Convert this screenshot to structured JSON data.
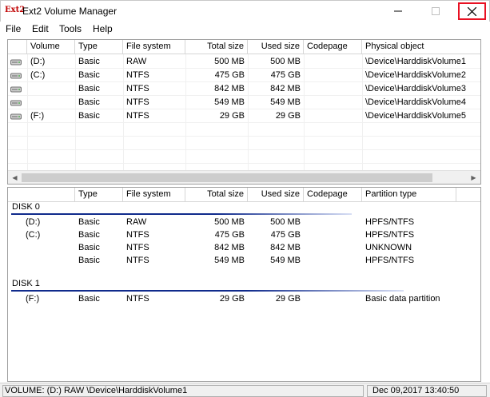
{
  "window": {
    "title": "Ext2 Volume Manager",
    "icon_text": "Ext2"
  },
  "menu": [
    "File",
    "Edit",
    "Tools",
    "Help"
  ],
  "volumes": {
    "headers": [
      "Volume",
      "Type",
      "File system",
      "Total size",
      "Used size",
      "Codepage",
      "Physical object"
    ],
    "rows": [
      {
        "volume": "(D:)",
        "type": "Basic",
        "fs": "RAW",
        "total": "500 MB",
        "used": "500 MB",
        "codepage": "",
        "object": "\\Device\\HarddiskVolume1"
      },
      {
        "volume": "(C:)",
        "type": "Basic",
        "fs": "NTFS",
        "total": "475 GB",
        "used": "475 GB",
        "codepage": "",
        "object": "\\Device\\HarddiskVolume2"
      },
      {
        "volume": "",
        "type": "Basic",
        "fs": "NTFS",
        "total": "842 MB",
        "used": "842 MB",
        "codepage": "",
        "object": "\\Device\\HarddiskVolume3"
      },
      {
        "volume": "",
        "type": "Basic",
        "fs": "NTFS",
        "total": "549 MB",
        "used": "549 MB",
        "codepage": "",
        "object": "\\Device\\HarddiskVolume4"
      },
      {
        "volume": "(F:)",
        "type": "Basic",
        "fs": "NTFS",
        "total": "29 GB",
        "used": "29 GB",
        "codepage": "",
        "object": "\\Device\\HarddiskVolume5"
      }
    ]
  },
  "disks": {
    "headers": [
      "",
      "Type",
      "File system",
      "Total size",
      "Used size",
      "Codepage",
      "Partition type"
    ],
    "groups": [
      {
        "label": "DISK 0",
        "rows": [
          {
            "volume": "(D:)",
            "type": "Basic",
            "fs": "RAW",
            "total": "500 MB",
            "used": "500 MB",
            "codepage": "",
            "ptype": "HPFS/NTFS"
          },
          {
            "volume": "(C:)",
            "type": "Basic",
            "fs": "NTFS",
            "total": "475 GB",
            "used": "475 GB",
            "codepage": "",
            "ptype": "HPFS/NTFS"
          },
          {
            "volume": "",
            "type": "Basic",
            "fs": "NTFS",
            "total": "842 MB",
            "used": "842 MB",
            "codepage": "",
            "ptype": "UNKNOWN"
          },
          {
            "volume": "",
            "type": "Basic",
            "fs": "NTFS",
            "total": "549 MB",
            "used": "549 MB",
            "codepage": "",
            "ptype": "HPFS/NTFS"
          }
        ]
      },
      {
        "label": "DISK 1",
        "rows": [
          {
            "volume": "(F:)",
            "type": "Basic",
            "fs": "NTFS",
            "total": "29 GB",
            "used": "29 GB",
            "codepage": "",
            "ptype": "Basic data partition"
          }
        ]
      }
    ]
  },
  "status": {
    "left": "VOLUME: (D:) RAW \\Device\\HarddiskVolume1",
    "right": "Dec 09,2017 13:40:50"
  },
  "icons": {
    "drive": "drive-icon",
    "minimize": "minimize-icon",
    "maximize": "maximize-icon",
    "close": "close-icon"
  },
  "colors": {
    "close_highlight": "#e81123",
    "disk_line": "#102b8c"
  }
}
